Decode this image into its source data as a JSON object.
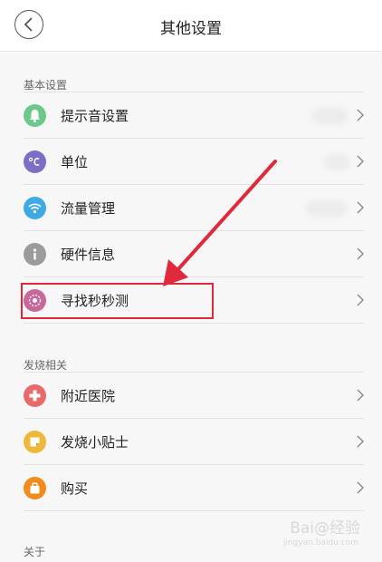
{
  "header": {
    "title": "其他设置"
  },
  "sections": {
    "basic": {
      "title": "基本设置",
      "items": [
        {
          "label": "提示音设置",
          "icon": "bell-icon",
          "color": "#6cc98b"
        },
        {
          "label": "单位",
          "icon": "celsius-icon",
          "color": "#7d6dc4"
        },
        {
          "label": "流量管理",
          "icon": "wifi-icon",
          "color": "#3fa9e6"
        },
        {
          "label": "硬件信息",
          "icon": "info-icon",
          "color": "#9b9b9b"
        },
        {
          "label": "寻找秒秒测",
          "icon": "find-device-icon",
          "color": "#c8689a"
        }
      ]
    },
    "fever": {
      "title": "发烧相关",
      "items": [
        {
          "label": "附近医院",
          "icon": "hospital-cross-icon",
          "color": "#e86a6a"
        },
        {
          "label": "发烧小贴士",
          "icon": "note-icon",
          "color": "#f0b83a"
        },
        {
          "label": "购买",
          "icon": "shopping-bag-icon",
          "color": "#f28b1e"
        }
      ]
    },
    "about": {
      "title": "关于"
    }
  },
  "annotation": {
    "color": "#e0293b"
  },
  "watermark": {
    "main": "Bai@经验",
    "sub": "jingyan.baidu.com"
  }
}
